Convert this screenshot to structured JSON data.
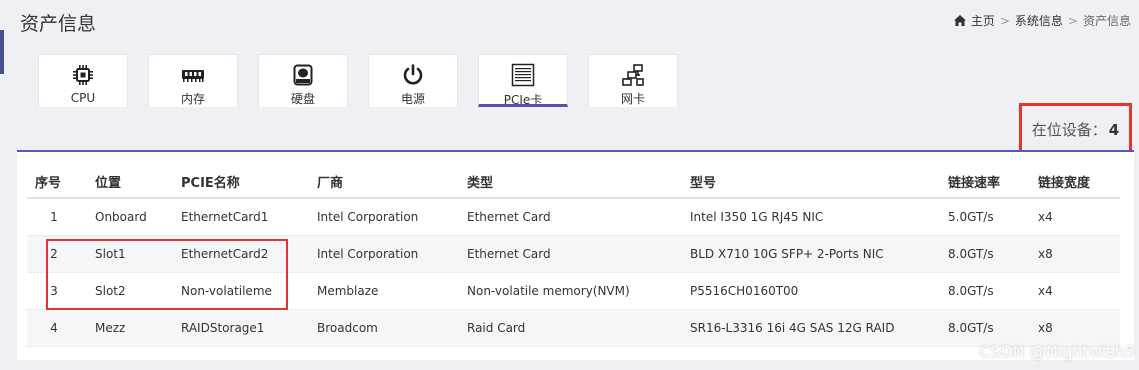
{
  "header": {
    "title": "资产信息"
  },
  "breadcrumb": {
    "home": "主页",
    "parent": "系统信息",
    "current": "资产信息",
    "separator": ">"
  },
  "tabs": [
    {
      "label": "CPU",
      "icon": "cpu-icon"
    },
    {
      "label": "内存",
      "icon": "memory-icon"
    },
    {
      "label": "硬盘",
      "icon": "disk-icon"
    },
    {
      "label": "电源",
      "icon": "power-icon"
    },
    {
      "label": "PCIe卡",
      "icon": "pcie-icon",
      "active": true
    },
    {
      "label": "网卡",
      "icon": "network-icon"
    }
  ],
  "device_count": {
    "label": "在位设备：",
    "value": "4"
  },
  "table": {
    "headers": [
      "序号",
      "位置",
      "PCIE名称",
      "厂商",
      "类型",
      "型号",
      "链接速率",
      "链接宽度"
    ],
    "rows": [
      [
        "1",
        "Onboard",
        "EthernetCard1",
        "Intel Corporation",
        "Ethernet Card",
        "Intel I350 1G RJ45 NIC",
        "5.0GT/s",
        "x4"
      ],
      [
        "2",
        "Slot1",
        "EthernetCard2",
        "Intel Corporation",
        "Ethernet Card",
        "BLD X710 10G SFP+ 2-Ports NIC",
        "8.0GT/s",
        "x8"
      ],
      [
        "3",
        "Slot2",
        "Non-volatileme",
        "Memblaze",
        "Non-volatile memory(NVM)",
        "P5516CH0160T00",
        "8.0GT/s",
        "x4"
      ],
      [
        "4",
        "Mezz",
        "RAIDStorage1",
        "Broadcom",
        "Raid Card",
        "SR16-L3316 16i 4G SAS 12G RAID",
        "8.0GT/s",
        "x8"
      ]
    ]
  },
  "watermark": "CSDN @Nightwish5",
  "colors": {
    "accent": "#5a57b3",
    "highlight": "#e3332f"
  }
}
